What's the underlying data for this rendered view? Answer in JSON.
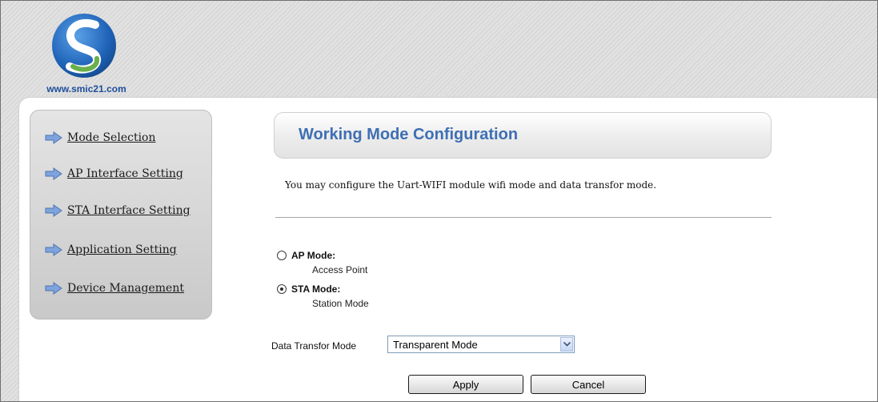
{
  "brand": {
    "url": "www.smic21.com",
    "colors": {
      "logo_blue": "#1f63b8",
      "logo_green": "#6ab04c",
      "title_blue": "#3f6fb3"
    }
  },
  "sidebar": {
    "items": [
      {
        "label": "Mode Selection",
        "icon": "arrow-right-icon"
      },
      {
        "label": "AP Interface Setting",
        "icon": "arrow-right-icon"
      },
      {
        "label": "STA Interface Setting",
        "icon": "arrow-right-icon"
      },
      {
        "label": "Application Setting",
        "icon": "arrow-right-icon"
      },
      {
        "label": "Device Management",
        "icon": "arrow-right-icon"
      }
    ]
  },
  "main": {
    "title": "Working Mode Configuration",
    "description": "You may configure the Uart-WIFI module wifi mode and data transfor mode.",
    "modes": [
      {
        "label": "AP Mode:",
        "sub": "Access Point",
        "selected": false
      },
      {
        "label": "STA Mode:",
        "sub": "Station Mode",
        "selected": true
      }
    ],
    "data_transfor": {
      "label": "Data Transfor Mode",
      "selected": "Transparent Mode"
    },
    "buttons": {
      "apply": "Apply",
      "cancel": "Cancel"
    }
  }
}
